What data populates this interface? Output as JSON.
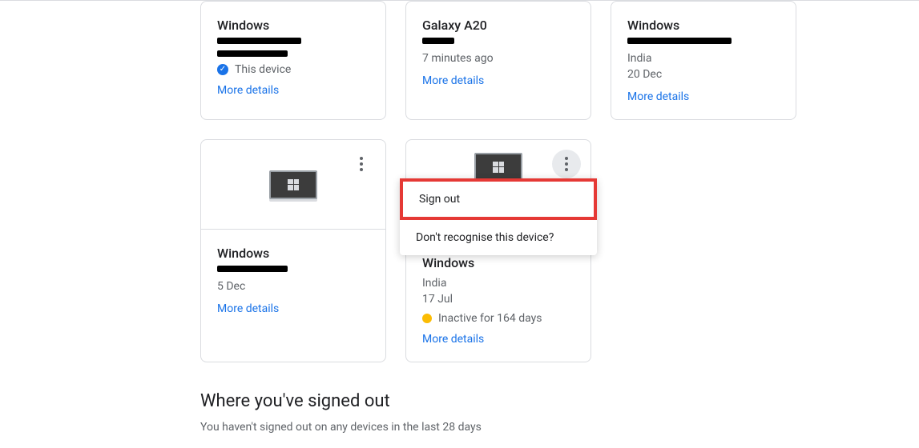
{
  "row1": {
    "c1": {
      "title": "Windows",
      "this_device": "This device",
      "more": "More details"
    },
    "c2": {
      "title": "Galaxy A20",
      "time": "7 minutes ago",
      "more": "More details"
    },
    "c3": {
      "title": "Windows",
      "loc": "India",
      "date": "20 Dec",
      "more": "More details"
    }
  },
  "row2": {
    "c1": {
      "title": "Windows",
      "date": "5 Dec",
      "more": "More details"
    },
    "c2": {
      "title": "Windows",
      "loc": "India",
      "date": "17 Jul",
      "inactive": "Inactive for 164 days",
      "more": "More details",
      "menu": {
        "signout": "Sign out",
        "dont": "Don't recognise this device?"
      }
    }
  },
  "signed_out": {
    "title": "Where you've signed out",
    "sub": "You haven't signed out on any devices in the last 28 days"
  }
}
